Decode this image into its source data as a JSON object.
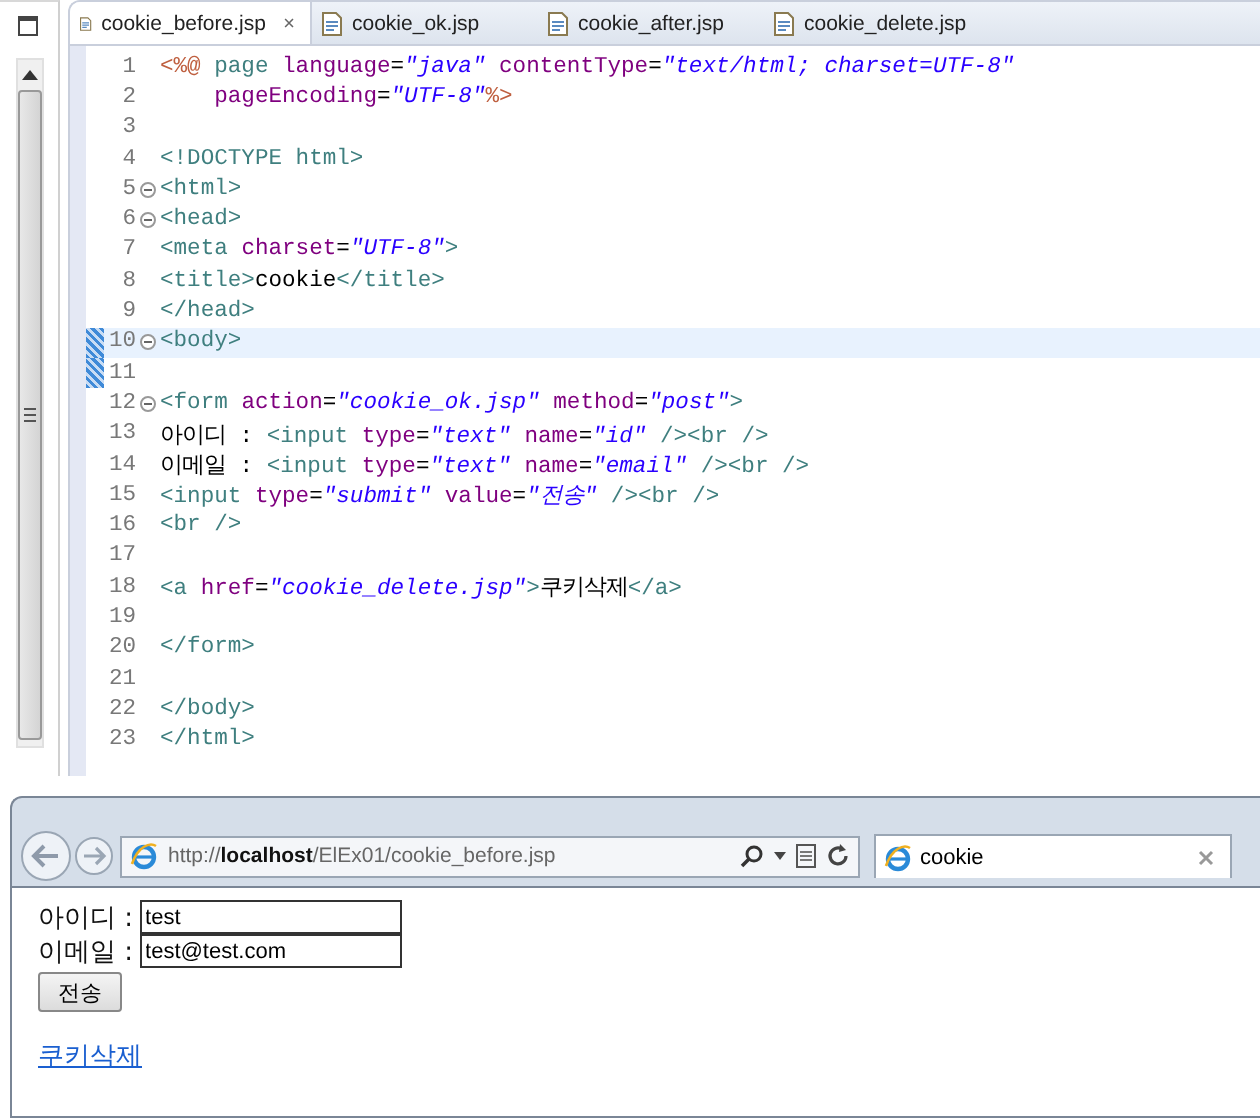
{
  "editor": {
    "tabs": [
      {
        "label": "cookie_before.jsp",
        "selected": true
      },
      {
        "label": "cookie_ok.jsp",
        "selected": false
      },
      {
        "label": "cookie_after.jsp",
        "selected": false
      },
      {
        "label": "cookie_delete.jsp",
        "selected": false
      }
    ],
    "lines": [
      {
        "number": "1",
        "fold": false,
        "current": false,
        "marked": false,
        "text": "<%@ page language=\"java\" contentType=\"text/html; charset=UTF-8\""
      },
      {
        "number": "2",
        "fold": false,
        "current": false,
        "marked": false,
        "text": "    pageEncoding=\"UTF-8\"%>"
      },
      {
        "number": "3",
        "fold": false,
        "current": false,
        "marked": false
      },
      {
        "number": "4",
        "fold": false,
        "current": false,
        "marked": false,
        "text": "<!DOCTYPE html>"
      },
      {
        "number": "5",
        "fold": true,
        "current": false,
        "marked": false,
        "text": "<html>"
      },
      {
        "number": "6",
        "fold": true,
        "current": false,
        "marked": false,
        "text": "<head>"
      },
      {
        "number": "7",
        "fold": false,
        "current": false,
        "marked": false,
        "text": "<meta charset=\"UTF-8\">"
      },
      {
        "number": "8",
        "fold": false,
        "current": false,
        "marked": false,
        "text": "<title>cookie</title>"
      },
      {
        "number": "9",
        "fold": false,
        "current": false,
        "marked": false,
        "text": "</head>"
      },
      {
        "number": "10",
        "fold": true,
        "current": true,
        "marked": true,
        "text": "<body>"
      },
      {
        "number": "11",
        "fold": false,
        "current": false,
        "marked": true
      },
      {
        "number": "12",
        "fold": true,
        "current": false,
        "marked": false,
        "text": "<form action=\"cookie_ok.jsp\" method=\"post\">"
      },
      {
        "number": "13",
        "fold": false,
        "current": false,
        "marked": false,
        "text": "아이디 : <input type=\"text\" name=\"id\" /><br />"
      },
      {
        "number": "14",
        "fold": false,
        "current": false,
        "marked": false,
        "text": "이메일 : <input type=\"text\" name=\"email\" /><br />"
      },
      {
        "number": "15",
        "fold": false,
        "current": false,
        "marked": false,
        "text": "<input type=\"submit\" value=\"전송\" /><br />"
      },
      {
        "number": "16",
        "fold": false,
        "current": false,
        "marked": false,
        "text": "<br />"
      },
      {
        "number": "17",
        "fold": false,
        "current": false,
        "marked": false
      },
      {
        "number": "18",
        "fold": false,
        "current": false,
        "marked": false,
        "text": "<a href=\"cookie_delete.jsp\">쿠키삭제</a>"
      },
      {
        "number": "19",
        "fold": false,
        "current": false,
        "marked": false
      },
      {
        "number": "20",
        "fold": false,
        "current": false,
        "marked": false,
        "text": "</form>"
      },
      {
        "number": "21",
        "fold": false,
        "current": false,
        "marked": false
      },
      {
        "number": "22",
        "fold": false,
        "current": false,
        "marked": false,
        "text": "</body>"
      },
      {
        "number": "23",
        "fold": false,
        "current": false,
        "marked": false,
        "text": "</html>"
      }
    ]
  },
  "browser": {
    "address": "http://**localhost**/ElEx01/cookie_before.jsp",
    "tab_title": "cookie",
    "fields": [
      {
        "label": "아이디 :",
        "value": "test"
      },
      {
        "label": "이메일 :",
        "value": "test@test.com"
      }
    ],
    "submit": "전송",
    "link": "쿠키삭제"
  }
}
